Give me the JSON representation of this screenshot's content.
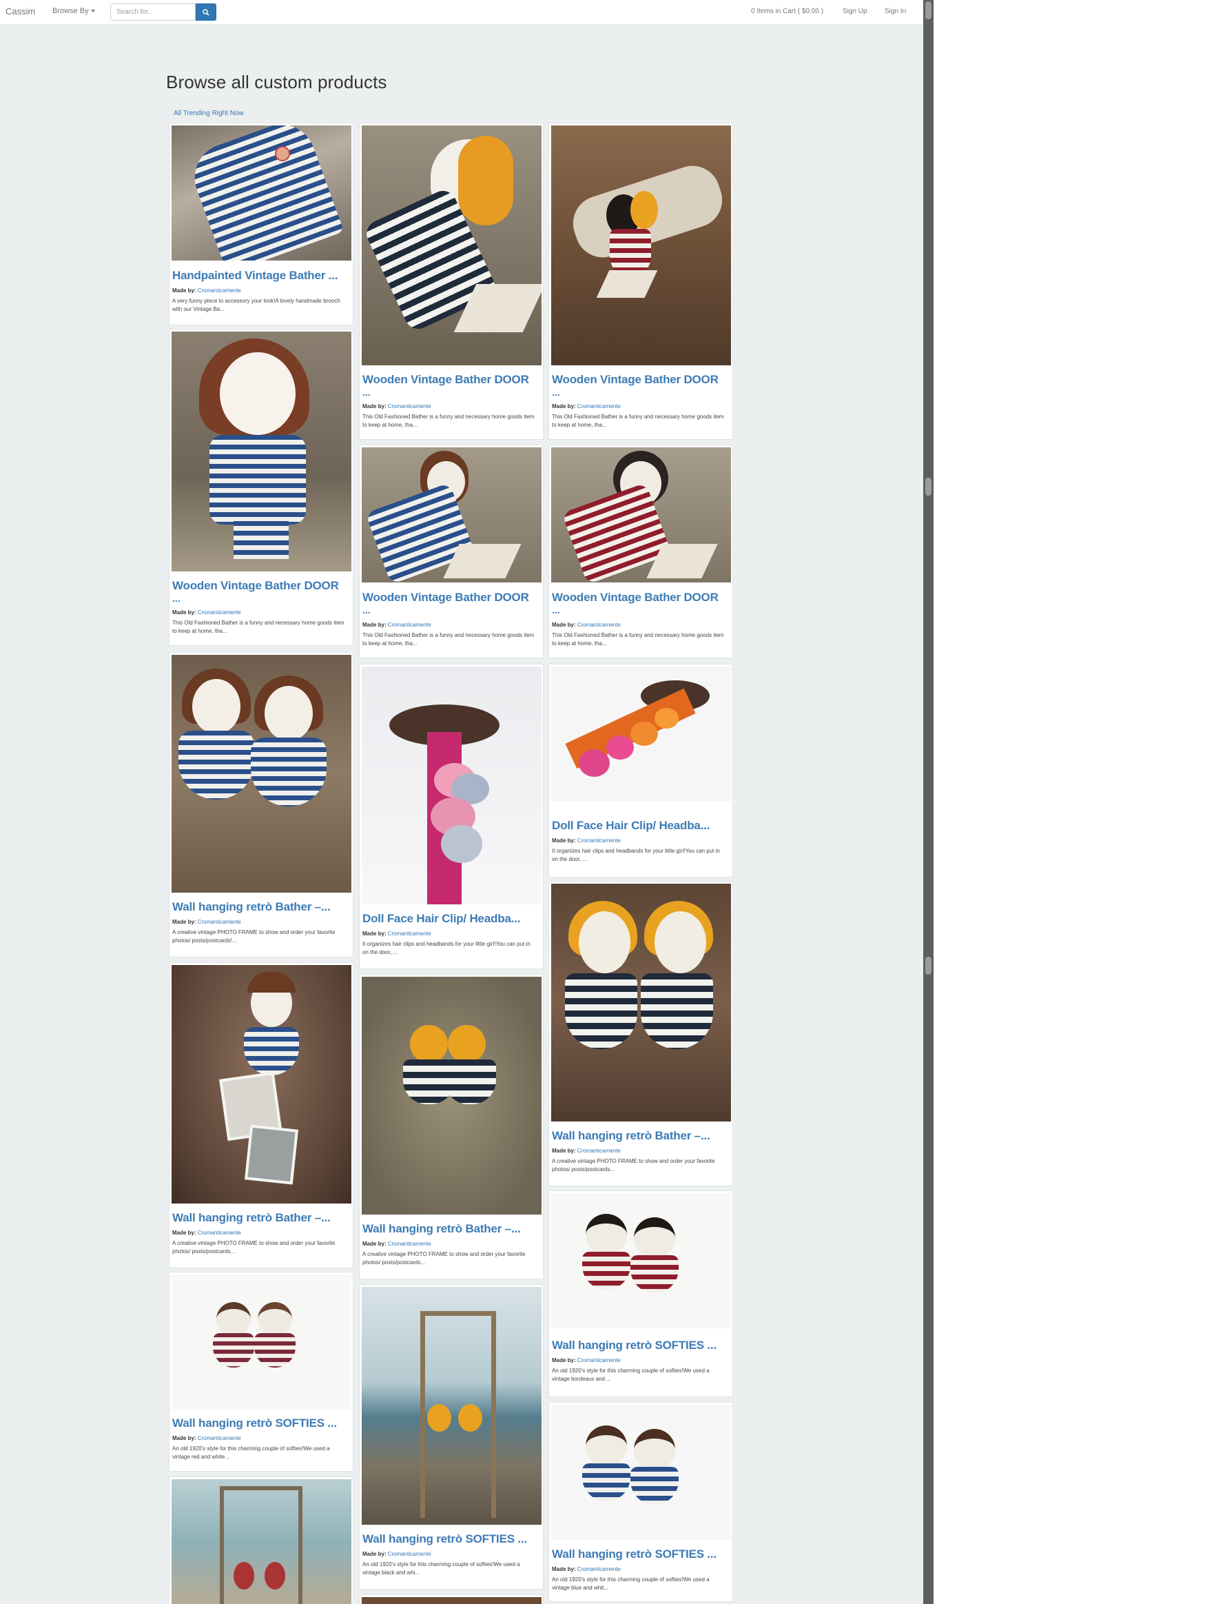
{
  "navbar": {
    "brand": "Cassim",
    "browse_label": "Browse By",
    "search_placeholder": "Search for..",
    "cart_label": "0 Items in Cart ( $0.00 )",
    "signup_label": "Sign Up",
    "signin_label": "Sign In"
  },
  "page": {
    "title": "Browse all custom products",
    "trending_link": "All Trending Right Now"
  },
  "maker_prefix": "Made by:",
  "products": [
    {
      "title": "Handpainted Vintage Bather ...",
      "maker": "Cromanticamente",
      "desc": "A very funny piece to accessory your look!A lovely handmade brooch with our Vintage Ba..."
    },
    {
      "title": "Wooden Vintage Bather DOOR",
      "maker": "Cromanticamente",
      "desc": "This Old Fashioned Bather is a funny and necessary home goods item to keep at home, tha..."
    },
    {
      "title": "Wooden Vintage Bather DOOR",
      "maker": "Cromanticamente",
      "desc": "This Old Fashioned Bather is a funny and necessary home goods item to keep at home, tha..."
    },
    {
      "title": "Wooden Vintage Bather DOOR",
      "maker": "Cromanticamente",
      "desc": "This Old Fashioned Bather is a funny and necessary home goods item to keep at home, tha..."
    },
    {
      "title": "Wooden Vintage Bather DOOR",
      "maker": "Cromanticamente",
      "desc": "This Old Fashioned Bather is a funny and necessary home goods item to keep at home, tha..."
    },
    {
      "title": "Wooden Vintage Bather DOOR",
      "maker": "Cromanticamente",
      "desc": "This Old Fashioned Bather is a funny and necessary home goods item to keep at home, tha..."
    },
    {
      "title": "Wall hanging retrò Bather –...",
      "maker": "Cromanticamente",
      "desc": "A creative vintage PHOTO FRAME to show and order your favorite photos/ posts/postcards!..."
    },
    {
      "title": "Doll Face Hair Clip/ Headba...",
      "maker": "Cromanticamente",
      "desc": "It organizes hair clips and headbands for your little girl!You can put in on the door, ..."
    },
    {
      "title": "Doll Face Hair Clip/ Headba...",
      "maker": "Cromanticamente",
      "desc": "It organizes hair clips and headbands for your little girl!You can put in on the door, ..."
    },
    {
      "title": "Wall hanging retrò Bather –...",
      "maker": "Cromanticamente",
      "desc": "A creative vintage PHOTO FRAME to show and order your favorite photos/ posts/postcards..."
    },
    {
      "title": "Wall hanging retrò Bather –...",
      "maker": "Cromanticamente",
      "desc": "A creative vintage PHOTO FRAME to show and order your favorite photos/ posts/postcards..."
    },
    {
      "title": "Wall hanging retrò Bather –...",
      "maker": "Cromanticamente",
      "desc": "A creative vintage PHOTO FRAME to show and order your favorite photos/ posts/postcards..."
    },
    {
      "title": "Wall hanging retrò SOFTIES ...",
      "maker": "Cromanticamente",
      "desc": "An old 1920's style for this charming couple of softies!We used a vintage red and white..."
    },
    {
      "title": "Wall hanging retrò SOFTIES ...",
      "maker": "Cromanticamente",
      "desc": "An old 1920's style for this charming couple of softies!We used a vintage bordeaux and ..."
    },
    {
      "title": "Wall hanging retrò SOFTIES ...",
      "maker": "Cromanticamente",
      "desc": "An old 1920's style for this charming couple of softies!We used a vintage black and whi..."
    },
    {
      "title": "Wall hanging retrò SOFTIES ...",
      "maker": "Cromanticamente",
      "desc": "An old 1920's style for this charming couple of softies!We used a vintage blue and whit..."
    }
  ],
  "colors": {
    "link": "#3d7bb5",
    "search_button": "#3276b1",
    "page_bg": "#eceff0"
  }
}
